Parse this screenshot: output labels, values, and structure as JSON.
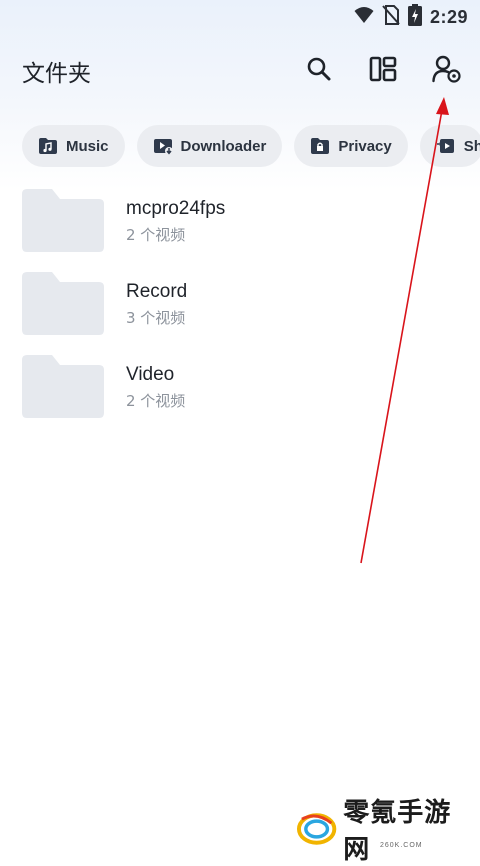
{
  "status_bar": {
    "time": "2:29",
    "icons": [
      "wifi-icon",
      "no-sim-icon",
      "battery-charging-icon"
    ]
  },
  "app_bar": {
    "title": "文件夹",
    "actions": [
      "search-icon",
      "layout-toggle-icon",
      "account-settings-icon"
    ]
  },
  "chips": [
    {
      "label": "Music",
      "icon": "music-folder-icon"
    },
    {
      "label": "Downloader",
      "icon": "download-folder-icon"
    },
    {
      "label": "Privacy",
      "icon": "lock-folder-icon"
    },
    {
      "label": "Sh",
      "icon": "share-folder-icon"
    }
  ],
  "folders": [
    {
      "name": "mcpro24fps",
      "count": "2 个视频"
    },
    {
      "name": "Record",
      "count": "3 个视频"
    },
    {
      "name": "Video",
      "count": "2 个视频"
    }
  ],
  "annotation": {
    "color": "#d9141b"
  },
  "watermark": {
    "text": "零氪手游网",
    "sub": "260K.COM"
  },
  "colors": {
    "folder": "#e6e9ee",
    "chip_bg": "#ebedf1",
    "chip_icon": "#2f3a4c"
  }
}
